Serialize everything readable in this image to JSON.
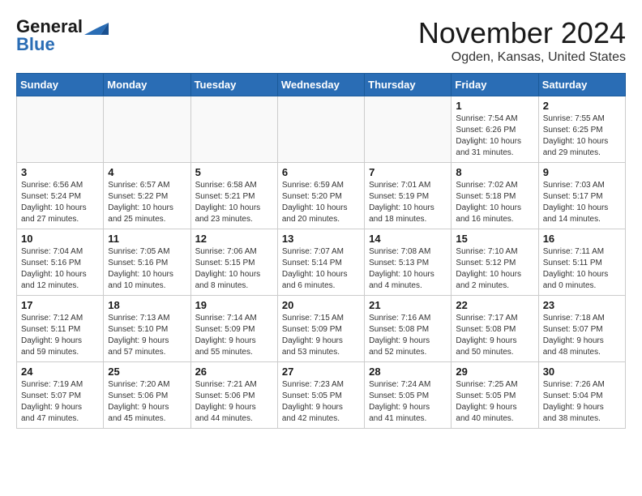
{
  "header": {
    "logo_line1": "General",
    "logo_line2": "Blue",
    "month_title": "November 2024",
    "location": "Ogden, Kansas, United States"
  },
  "weekdays": [
    "Sunday",
    "Monday",
    "Tuesday",
    "Wednesday",
    "Thursday",
    "Friday",
    "Saturday"
  ],
  "weeks": [
    [
      {
        "day": "",
        "info": ""
      },
      {
        "day": "",
        "info": ""
      },
      {
        "day": "",
        "info": ""
      },
      {
        "day": "",
        "info": ""
      },
      {
        "day": "",
        "info": ""
      },
      {
        "day": "1",
        "info": "Sunrise: 7:54 AM\nSunset: 6:26 PM\nDaylight: 10 hours and 31 minutes."
      },
      {
        "day": "2",
        "info": "Sunrise: 7:55 AM\nSunset: 6:25 PM\nDaylight: 10 hours and 29 minutes."
      }
    ],
    [
      {
        "day": "3",
        "info": "Sunrise: 6:56 AM\nSunset: 5:24 PM\nDaylight: 10 hours and 27 minutes."
      },
      {
        "day": "4",
        "info": "Sunrise: 6:57 AM\nSunset: 5:22 PM\nDaylight: 10 hours and 25 minutes."
      },
      {
        "day": "5",
        "info": "Sunrise: 6:58 AM\nSunset: 5:21 PM\nDaylight: 10 hours and 23 minutes."
      },
      {
        "day": "6",
        "info": "Sunrise: 6:59 AM\nSunset: 5:20 PM\nDaylight: 10 hours and 20 minutes."
      },
      {
        "day": "7",
        "info": "Sunrise: 7:01 AM\nSunset: 5:19 PM\nDaylight: 10 hours and 18 minutes."
      },
      {
        "day": "8",
        "info": "Sunrise: 7:02 AM\nSunset: 5:18 PM\nDaylight: 10 hours and 16 minutes."
      },
      {
        "day": "9",
        "info": "Sunrise: 7:03 AM\nSunset: 5:17 PM\nDaylight: 10 hours and 14 minutes."
      }
    ],
    [
      {
        "day": "10",
        "info": "Sunrise: 7:04 AM\nSunset: 5:16 PM\nDaylight: 10 hours and 12 minutes."
      },
      {
        "day": "11",
        "info": "Sunrise: 7:05 AM\nSunset: 5:16 PM\nDaylight: 10 hours and 10 minutes."
      },
      {
        "day": "12",
        "info": "Sunrise: 7:06 AM\nSunset: 5:15 PM\nDaylight: 10 hours and 8 minutes."
      },
      {
        "day": "13",
        "info": "Sunrise: 7:07 AM\nSunset: 5:14 PM\nDaylight: 10 hours and 6 minutes."
      },
      {
        "day": "14",
        "info": "Sunrise: 7:08 AM\nSunset: 5:13 PM\nDaylight: 10 hours and 4 minutes."
      },
      {
        "day": "15",
        "info": "Sunrise: 7:10 AM\nSunset: 5:12 PM\nDaylight: 10 hours and 2 minutes."
      },
      {
        "day": "16",
        "info": "Sunrise: 7:11 AM\nSunset: 5:11 PM\nDaylight: 10 hours and 0 minutes."
      }
    ],
    [
      {
        "day": "17",
        "info": "Sunrise: 7:12 AM\nSunset: 5:11 PM\nDaylight: 9 hours and 59 minutes."
      },
      {
        "day": "18",
        "info": "Sunrise: 7:13 AM\nSunset: 5:10 PM\nDaylight: 9 hours and 57 minutes."
      },
      {
        "day": "19",
        "info": "Sunrise: 7:14 AM\nSunset: 5:09 PM\nDaylight: 9 hours and 55 minutes."
      },
      {
        "day": "20",
        "info": "Sunrise: 7:15 AM\nSunset: 5:09 PM\nDaylight: 9 hours and 53 minutes."
      },
      {
        "day": "21",
        "info": "Sunrise: 7:16 AM\nSunset: 5:08 PM\nDaylight: 9 hours and 52 minutes."
      },
      {
        "day": "22",
        "info": "Sunrise: 7:17 AM\nSunset: 5:08 PM\nDaylight: 9 hours and 50 minutes."
      },
      {
        "day": "23",
        "info": "Sunrise: 7:18 AM\nSunset: 5:07 PM\nDaylight: 9 hours and 48 minutes."
      }
    ],
    [
      {
        "day": "24",
        "info": "Sunrise: 7:19 AM\nSunset: 5:07 PM\nDaylight: 9 hours and 47 minutes."
      },
      {
        "day": "25",
        "info": "Sunrise: 7:20 AM\nSunset: 5:06 PM\nDaylight: 9 hours and 45 minutes."
      },
      {
        "day": "26",
        "info": "Sunrise: 7:21 AM\nSunset: 5:06 PM\nDaylight: 9 hours and 44 minutes."
      },
      {
        "day": "27",
        "info": "Sunrise: 7:23 AM\nSunset: 5:05 PM\nDaylight: 9 hours and 42 minutes."
      },
      {
        "day": "28",
        "info": "Sunrise: 7:24 AM\nSunset: 5:05 PM\nDaylight: 9 hours and 41 minutes."
      },
      {
        "day": "29",
        "info": "Sunrise: 7:25 AM\nSunset: 5:05 PM\nDaylight: 9 hours and 40 minutes."
      },
      {
        "day": "30",
        "info": "Sunrise: 7:26 AM\nSunset: 5:04 PM\nDaylight: 9 hours and 38 minutes."
      }
    ]
  ]
}
